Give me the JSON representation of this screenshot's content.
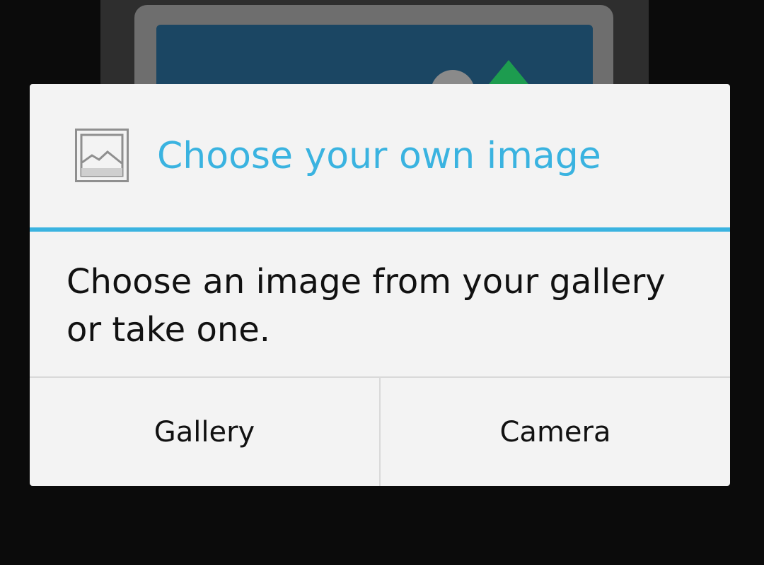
{
  "dialog": {
    "title": "Choose your own image",
    "icon": "image-icon",
    "message": "Choose an image from your gallery or take one.",
    "buttons": {
      "gallery": "Gallery",
      "camera": "Camera"
    }
  },
  "colors": {
    "accent": "#3ab3e0",
    "dialog_bg": "#f3f3f3",
    "scrim": "#0b0b0b",
    "text": "#111111"
  }
}
